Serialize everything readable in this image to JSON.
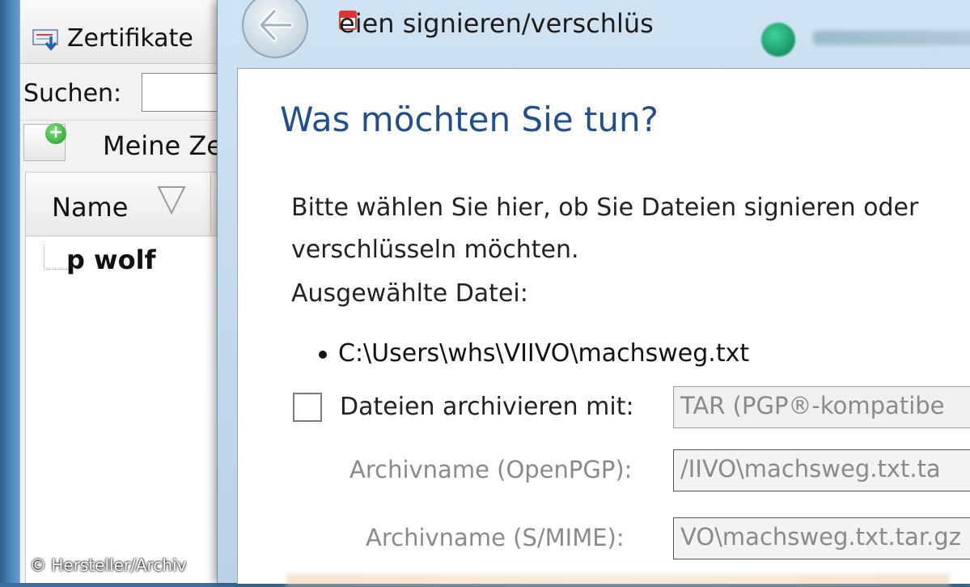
{
  "background_window": {
    "toolbar_button": "Zertifikate",
    "search_label": "Suchen:",
    "search_value": "",
    "my_certs_label": "Meine Ze",
    "column_name": "Name",
    "rows": [
      "p wolf"
    ]
  },
  "dialog": {
    "title": "eien signieren/verschlüs",
    "heading": "Was möchten Sie tun?",
    "description_line1": "Bitte wählen Sie hier, ob Sie Dateien signieren oder",
    "description_line2": "verschlüsseln möchten.",
    "selected_file_label": "Ausgewählte Datei:",
    "selected_file": "C:\\Users\\whs\\VIIVO\\machsweg.txt",
    "archive_checkbox_label": "Dateien archivieren mit:",
    "archive_checked": false,
    "archive_format": "TAR (PGP®-kompatibe",
    "archive_name_openpgp_label": "Archivname (OpenPGP):",
    "archive_name_openpgp_value": "/IIVO\\machsweg.txt.ta",
    "archive_name_smime_label": "Archivname (S/MIME):",
    "archive_name_smime_value": "VO\\machsweg.txt.tar.gz"
  },
  "watermark": "© Hersteller/Archiv",
  "colors": {
    "heading": "#1f4f8f",
    "dialog_frame": "#b9d2e6",
    "disabled_text": "#8a8a8a"
  }
}
